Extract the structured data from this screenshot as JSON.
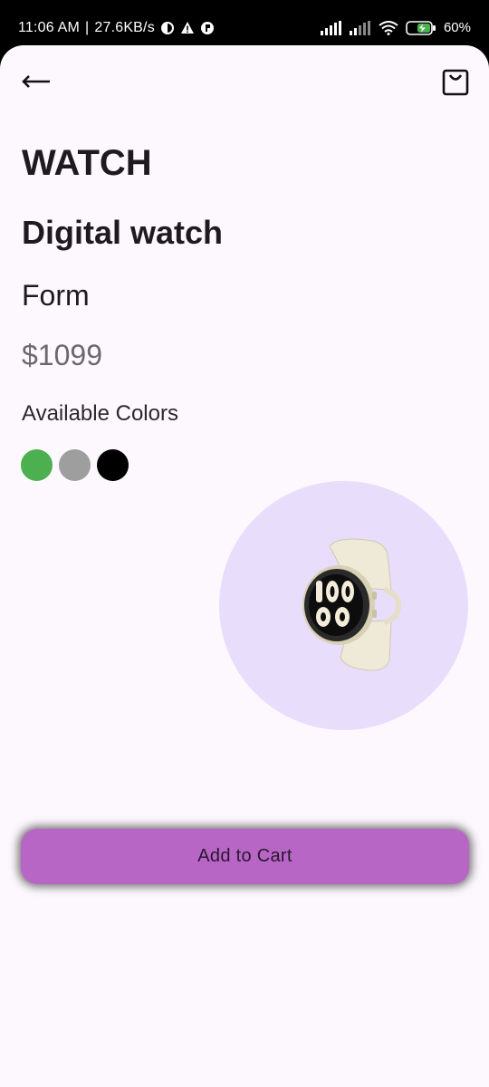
{
  "status_bar": {
    "time": "11:06 AM",
    "network_speed": "27.6KB/s",
    "battery": "60%"
  },
  "header": {
    "back_icon": "arrow-left-icon",
    "bag_icon": "shopping-bag-icon"
  },
  "product": {
    "category": "WATCH",
    "name": "Digital watch",
    "form": "Form",
    "price": "$1099",
    "colors_label": "Available Colors",
    "colors": [
      "#4caf50",
      "#9e9e9e",
      "#000000"
    ],
    "image": "smartwatch-image",
    "circle_color": "#e9ddfc"
  },
  "actions": {
    "add_to_cart": "Add to Cart",
    "button_color": "#b866c6"
  }
}
